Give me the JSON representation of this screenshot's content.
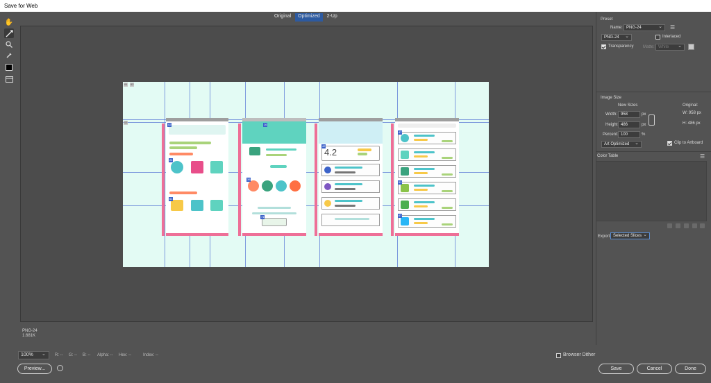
{
  "window": {
    "title": "Save for Web"
  },
  "view_tabs": [
    "Original",
    "Optimized",
    "2-Up"
  ],
  "view_tab_selected": "Optimized",
  "tools": [
    "hand-tool-icon",
    "slice-select-tool-icon",
    "zoom-tool-icon",
    "eyedropper-tool-icon",
    "eyedropper-color-swatch",
    "toggle-slices-icon"
  ],
  "status": {
    "format": "PNG-24",
    "size": "1.681K"
  },
  "bottom": {
    "zoom": "100%",
    "readouts": [
      "R: --",
      "G: --",
      "B: --",
      "Alpha: --",
      "Hex: --",
      "Index: --"
    ],
    "preview_label": "Preview...",
    "browser_dither_label": "Browser Dither",
    "save_label": "Save",
    "cancel_label": "Cancel",
    "done_label": "Done"
  },
  "preset": {
    "section_label": "Preset",
    "name_label": "Name:",
    "name_value": "PNG-24",
    "format_value": "PNG-24",
    "interlaced_label": "Interlaced",
    "interlaced_checked": false,
    "transparency_label": "Transparency",
    "transparency_checked": true,
    "matte_label": "Matte:",
    "matte_value": "White"
  },
  "image_size": {
    "section_label": "Image Size",
    "new_sizes_label": "New Sizes",
    "original_label": "Original:",
    "width_label": "Width:",
    "width_value": "958",
    "height_label": "Height:",
    "height_value": "486",
    "percent_label": "Percent:",
    "percent_value": "100",
    "unit_px": "px",
    "unit_pct": "%",
    "orig_w": "W:  958 px",
    "orig_h": "H:  486 px",
    "art_optimized": "Art Optimized",
    "clip_label": "Clip to Artboard",
    "clip_checked": true
  },
  "color_table": {
    "section_label": "Color Table"
  },
  "export": {
    "label": "Export:",
    "value": "Selected Slices"
  },
  "slice_labels": [
    "01",
    "02",
    "03",
    "16",
    "24",
    "36",
    "42",
    "47",
    "51",
    "61",
    "67",
    "71"
  ],
  "rating_text": "4.2",
  "colors": {
    "background": "#535353",
    "artboard": "#e3fbf4",
    "accent_pink": "#ee6f97",
    "accent_teal": "#5fd3bf",
    "accent_blue": "#2d5aa0",
    "slice_blue": "#3c63c9",
    "guide_blue": "#5a78d6"
  }
}
